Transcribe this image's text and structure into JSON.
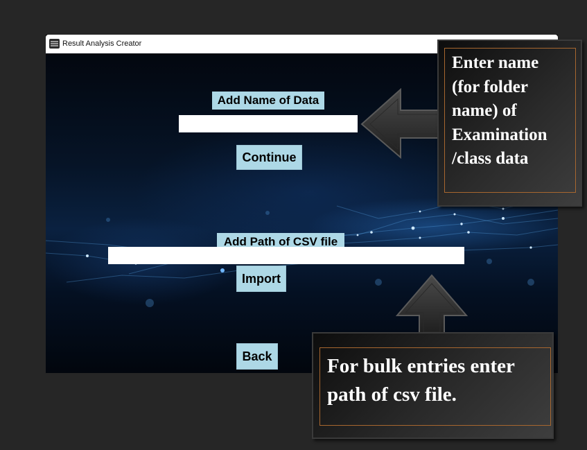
{
  "window": {
    "title": "Result Analysis Creator"
  },
  "form": {
    "name_label": "Add Name of Data",
    "name_value": "",
    "continue_label": "Continue",
    "csv_label": "Add Path of CSV file",
    "csv_value": "",
    "import_label": "Import",
    "back_label": "Back"
  },
  "callouts": {
    "name_hint": "Enter name (for folder name) of Examination /class data",
    "csv_hint": "For bulk entries enter path of csv file."
  }
}
